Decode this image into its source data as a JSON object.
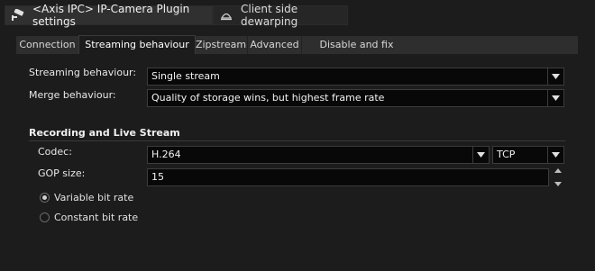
{
  "toolbar": {
    "plugin_title": "<Axis IPC> IP-Camera Plugin settings",
    "plugin_icon": "camera-icon",
    "dewarp_label": "Client side dewarping",
    "dewarp_icon": "fisheye-icon"
  },
  "tabs": [
    {
      "label": "Connection",
      "active": false
    },
    {
      "label": "Streaming behaviour",
      "active": true
    },
    {
      "label": "Zipstream",
      "active": false
    },
    {
      "label": "Advanced",
      "active": false
    },
    {
      "label": "Disable and fix settings",
      "active": false
    }
  ],
  "streaming": {
    "behaviour_label": "Streaming behaviour:",
    "behaviour_value": "Single stream",
    "merge_label": "Merge behaviour:",
    "merge_value": "Quality of storage wins, but highest frame rate"
  },
  "recording": {
    "section_title": "Recording and Live Stream",
    "codec_label": "Codec:",
    "codec_value": "H.264",
    "protocol_value": "TCP",
    "gop_label": "GOP size:",
    "gop_value": "15",
    "bitrate_options": [
      {
        "label": "Variable bit rate",
        "selected": true
      },
      {
        "label": "Constant bit rate",
        "selected": false
      }
    ]
  },
  "colors": {
    "background": "#1c1c1c",
    "field_background": "#080808",
    "tab_bar": "#2e2e2e"
  }
}
